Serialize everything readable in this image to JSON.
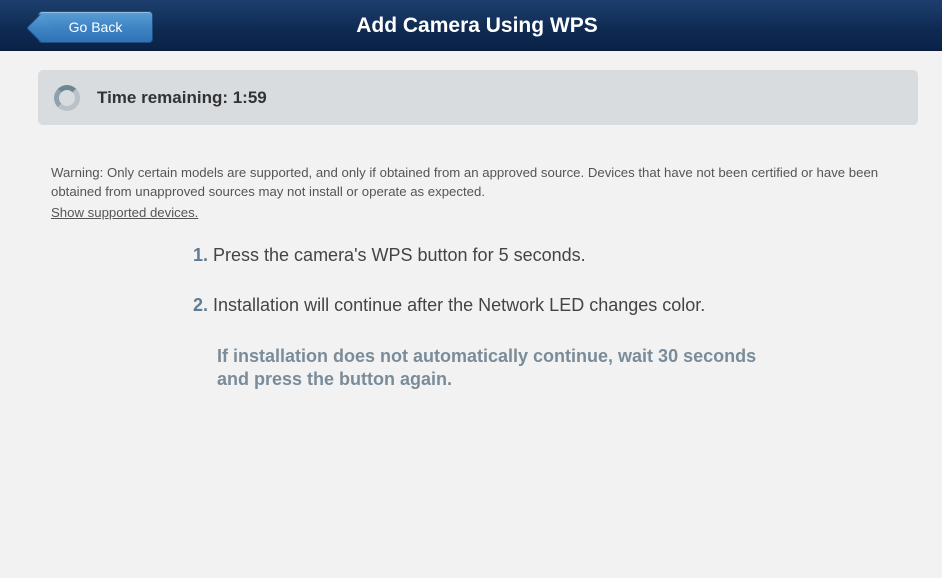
{
  "header": {
    "back_label": "Go Back",
    "title": "Add Camera Using WPS"
  },
  "timer": {
    "label": "Time remaining: 1:59",
    "icon": "spinner-icon"
  },
  "warning": {
    "text": "Warning: Only certain models are supported, and only if obtained from an approved source. Devices that have not been certified or have been obtained from unapproved sources may not install or operate as expected.",
    "link": "Show supported devices."
  },
  "steps": [
    {
      "num": "1.",
      "text": " Press the camera's WPS button for 5 seconds."
    },
    {
      "num": "2.",
      "text": " Installation will continue after the Network LED changes color."
    }
  ],
  "note": "If installation does not automatically continue, wait 30 seconds and press the button again.",
  "colors": {
    "header": "#0f2a52",
    "button": "#3f85c4",
    "step_number": "#5f7c94",
    "note": "#7a8c99"
  }
}
